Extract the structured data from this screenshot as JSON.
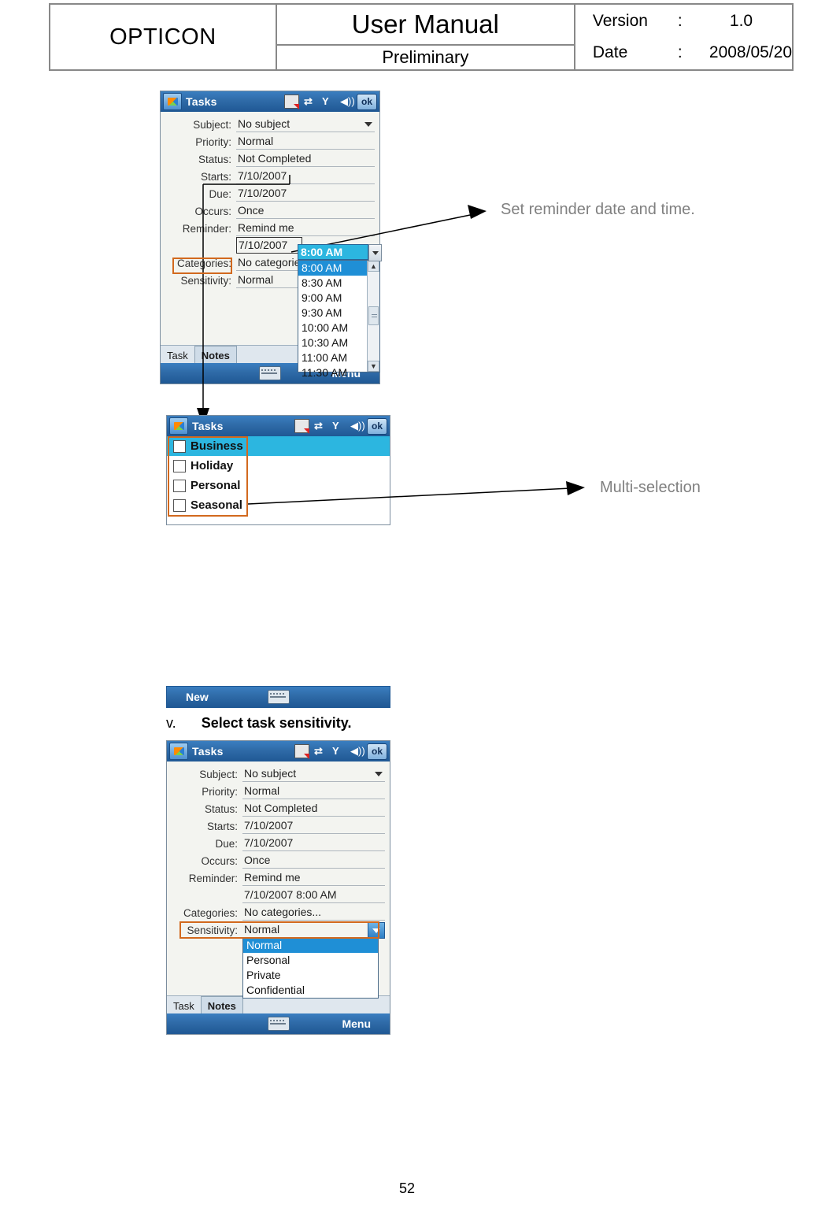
{
  "header": {
    "logo": "OPTICON",
    "title": "User Manual",
    "subtitle": "Preliminary",
    "version_label": "Version",
    "version_colon": ":",
    "version_value": "1.0",
    "date_label": "Date",
    "date_colon": ":",
    "date_value": "2008/05/20"
  },
  "screen1": {
    "titlebar": {
      "title": "Tasks",
      "ok": "ok"
    },
    "fields": [
      {
        "label": "Subject:",
        "value": "No subject",
        "caret": true
      },
      {
        "label": "Priority:",
        "value": "Normal",
        "caret": false
      },
      {
        "label": "Status:",
        "value": "Not Completed",
        "caret": false
      },
      {
        "label": "Starts:",
        "value": "7/10/2007",
        "caret": false
      },
      {
        "label": "Due:",
        "value": "7/10/2007",
        "caret": false
      },
      {
        "label": "Occurs:",
        "value": "Once",
        "caret": false
      },
      {
        "label": "Reminder:",
        "value": "Remind me",
        "caret": false
      }
    ],
    "reminder_date": "7/10/2007",
    "reminder_time": "8:00 AM",
    "categories_label": "Categories:",
    "categories_value": "No categories...",
    "sensitivity_label": "Sensitivity:",
    "sensitivity_value": "Normal",
    "time_options": [
      "8:00 AM",
      "8:30 AM",
      "9:00 AM",
      "9:30 AM",
      "10:00 AM",
      "10:30 AM",
      "11:00 AM",
      "11:30 AM"
    ],
    "time_selected": "8:00 AM",
    "tabs": [
      {
        "label": "Task",
        "selected": false
      },
      {
        "label": "Notes",
        "selected": true
      }
    ],
    "soft_right": "Menu"
  },
  "screen2": {
    "titlebar": {
      "title": "Tasks",
      "ok": "ok"
    },
    "categories": [
      {
        "label": "Business",
        "checked": false,
        "selected": true
      },
      {
        "label": "Holiday",
        "checked": false,
        "selected": false
      },
      {
        "label": "Personal",
        "checked": false,
        "selected": false
      },
      {
        "label": "Seasonal",
        "checked": false,
        "selected": false
      }
    ],
    "newbar_label": "New"
  },
  "screen3": {
    "titlebar": {
      "title": "Tasks",
      "ok": "ok"
    },
    "fields": [
      {
        "label": "Subject:",
        "value": "No subject",
        "caret": true
      },
      {
        "label": "Priority:",
        "value": "Normal",
        "caret": false
      },
      {
        "label": "Status:",
        "value": "Not Completed",
        "caret": false
      },
      {
        "label": "Starts:",
        "value": "7/10/2007",
        "caret": false
      },
      {
        "label": "Due:",
        "value": "7/10/2007",
        "caret": false
      },
      {
        "label": "Occurs:",
        "value": "Once",
        "caret": false
      },
      {
        "label": "Reminder:",
        "value": "Remind me",
        "caret": false
      }
    ],
    "reminder_datetime": "7/10/2007   8:00 AM",
    "categories_label": "Categories:",
    "categories_value": "No categories...",
    "sensitivity_label": "Sensitivity:",
    "sensitivity_value": "Normal",
    "sensitivity_options": [
      "Normal",
      "Personal",
      "Private",
      "Confidential"
    ],
    "sensitivity_selected": "Normal",
    "tabs": [
      {
        "label": "Task",
        "selected": false
      },
      {
        "label": "Notes",
        "selected": true
      }
    ],
    "soft_right": "Menu"
  },
  "annotations": {
    "reminder": "Set reminder date and time.",
    "multi_selection": "Multi-selection"
  },
  "step": {
    "num": "v.",
    "text": "Select task sensitivity."
  },
  "page_number": "52"
}
